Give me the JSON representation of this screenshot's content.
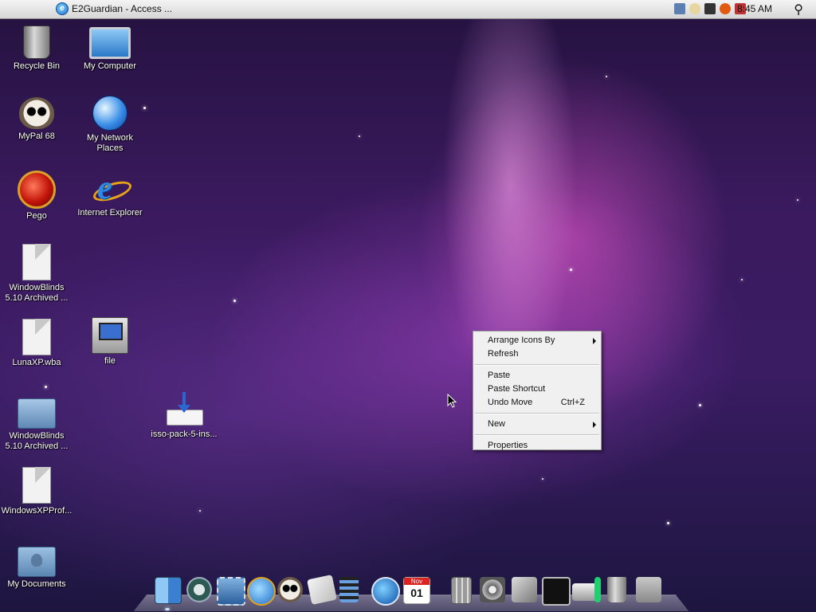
{
  "menubar": {
    "window_title": "E2Guardian - Access ...",
    "clock": "8:45 AM"
  },
  "desktop_icons": [
    {
      "label": "Recycle Bin"
    },
    {
      "label": "My Computer"
    },
    {
      "label": "MyPal 68"
    },
    {
      "label": "My Network Places"
    },
    {
      "label": "Pego"
    },
    {
      "label": "Internet Explorer"
    },
    {
      "label": "WindowBlinds 5.10 Archived ..."
    },
    {
      "label": "LunaXP.wba"
    },
    {
      "label": "file"
    },
    {
      "label": "WindowBlinds 5.10 Archived ..."
    },
    {
      "label": "isso-pack-5-ins..."
    },
    {
      "label": "WindowsXPProf..."
    },
    {
      "label": "My Documents"
    }
  ],
  "context_menu": {
    "arrange_icons_by": "Arrange Icons By",
    "refresh": "Refresh",
    "paste": "Paste",
    "paste_shortcut": "Paste Shortcut",
    "undo_move": "Undo Move",
    "undo_move_shortcut": "Ctrl+Z",
    "new": "New",
    "properties": "Properties"
  },
  "dock": {
    "calendar_month": "Nov",
    "calendar_day": "01"
  }
}
